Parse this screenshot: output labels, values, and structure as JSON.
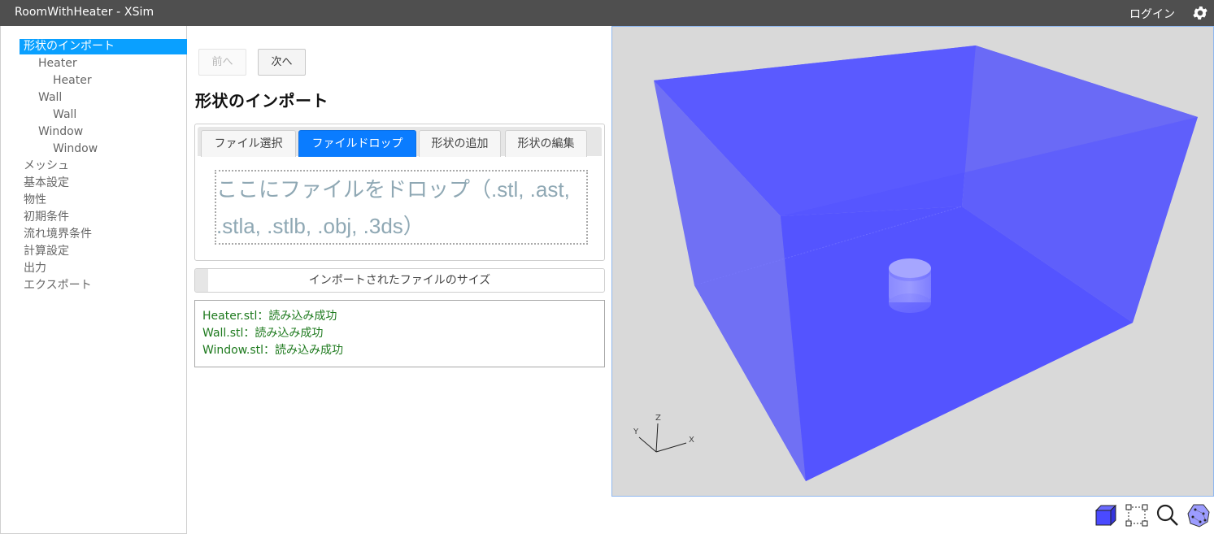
{
  "window": {
    "title": "RoomWithHeater - XSim",
    "login_label": "ログイン",
    "settings_icon": "gear-icon"
  },
  "sidebar": {
    "items": [
      {
        "label": "形状のインポート",
        "level": 0,
        "active": true
      },
      {
        "label": "Heater",
        "level": 1
      },
      {
        "label": "Heater",
        "level": 2
      },
      {
        "label": "Wall",
        "level": 1
      },
      {
        "label": "Wall",
        "level": 2
      },
      {
        "label": "Window",
        "level": 1
      },
      {
        "label": "Window",
        "level": 2
      },
      {
        "label": "メッシュ",
        "level": 0
      },
      {
        "label": "基本設定",
        "level": 0
      },
      {
        "label": "物性",
        "level": 0
      },
      {
        "label": "初期条件",
        "level": 0
      },
      {
        "label": "流れ境界条件",
        "level": 0
      },
      {
        "label": "計算設定",
        "level": 0
      },
      {
        "label": "出力",
        "level": 0
      },
      {
        "label": "エクスポート",
        "level": 0
      }
    ]
  },
  "panel": {
    "prev_label": "前へ",
    "prev_disabled": true,
    "next_label": "次へ",
    "title": "形状のインポート",
    "tabs": [
      {
        "label": "ファイル選択",
        "active": false
      },
      {
        "label": "ファイルドロップ",
        "active": true
      },
      {
        "label": "形状の追加",
        "active": false
      },
      {
        "label": "形状の編集",
        "active": false
      }
    ],
    "dropzone_text": "ここにファイルをドロップ（.stl, .ast, .stla, .stlb, .obj, .3ds）",
    "size_bar": {
      "label": "インポートされたファイルのサイズ"
    },
    "log": [
      "Heater.stl：読み込み成功",
      "Wall.stl：読み込み成功",
      "Window.stl：読み込み成功"
    ]
  },
  "viewport": {
    "background": "#d9d9d9",
    "object_color": "#5555ff",
    "axes": {
      "x": "X",
      "y": "Y",
      "z": "Z"
    },
    "objects": [
      "Wall",
      "Heater",
      "Window"
    ]
  },
  "toolbar3d": {
    "tools": [
      {
        "name": "solid-view-icon"
      },
      {
        "name": "box-select-icon"
      },
      {
        "name": "zoom-icon"
      },
      {
        "name": "point-cloud-icon"
      }
    ]
  },
  "colors": {
    "titlebar": "#4f4f4f",
    "sidebar_active": "#0aa0ff",
    "tab_active": "#0a7cff",
    "log_text": "#1e7a1e"
  }
}
